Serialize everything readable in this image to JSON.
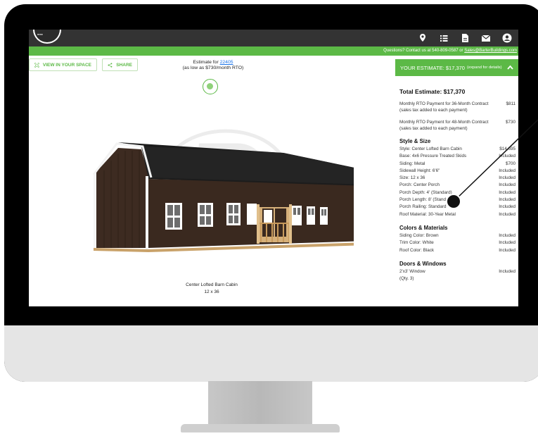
{
  "greenbar": {
    "prefix": "Questions? Contact us at 540-809-0587 or ",
    "email": "Sales@BarterBuildings.com"
  },
  "viewer": {
    "view_label": "VIEW IN YOUR SPACE",
    "share_label": "SHARE",
    "estimate_prefix": "Estimate for ",
    "zip": "22405",
    "rto_line": "(as low as $730/month RTO)",
    "model_name": "Center Lofted Barn Cabin",
    "model_size": "12 x 36"
  },
  "panel": {
    "header_main": "YOUR ESTIMATE: $17,370",
    "header_small": "(expand for details)",
    "total": "Total Estimate: $17,370",
    "payments": [
      {
        "label": "Monthly RTO Payment for 36-Month Contract (sales tax added to each payment)",
        "value": "$811"
      },
      {
        "label": "Monthly RTO Payment for 48-Month Contract (sales tax added to each payment)",
        "value": "$730"
      }
    ],
    "sections": {
      "style": {
        "title": "Style & Size",
        "rows": [
          {
            "label": "Style: Center Lofted Barn Cabin",
            "value": "$14,695"
          },
          {
            "label": "Base: 4x6 Pressure Treated Skids",
            "value": "Included"
          },
          {
            "label": "Siding: Metal",
            "value": "$700"
          },
          {
            "label": "Sidewall Height: 6'6\"",
            "value": "Included"
          },
          {
            "label": "Size: 12 x 36",
            "value": "Included"
          },
          {
            "label": "Porch: Center Porch",
            "value": "Included"
          },
          {
            "label": "Porch Depth: 4' (Standard)",
            "value": "Included"
          },
          {
            "label": "Porch Length: 8' (Standard)",
            "value": "Included"
          },
          {
            "label": "Porch Railing: Standard",
            "value": "Included"
          },
          {
            "label": "Roof Material: 30-Year Metal",
            "value": "Included"
          }
        ]
      },
      "colors": {
        "title": "Colors & Materials",
        "rows": [
          {
            "label": "Siding Color: Brown",
            "value": "Included"
          },
          {
            "label": "Trim Color: White",
            "value": "Included"
          },
          {
            "label": "Roof Color: Black",
            "value": "Included"
          }
        ]
      },
      "doors": {
        "title": "Doors & Windows",
        "rows": [
          {
            "label": "2'x3' Window",
            "value": "Included"
          },
          {
            "label": "(Qty. 3)",
            "value": ""
          }
        ]
      }
    }
  },
  "icons": [
    "logo",
    "location-pin-icon",
    "list-icon",
    "document-icon",
    "mail-icon",
    "account-icon",
    "ar-cube-icon",
    "share-icon",
    "chevron-up-icon"
  ],
  "colors": {
    "accent": "#5cb946",
    "topbar": "#333333",
    "siding": "#3d2b21",
    "roof": "#1a1a1a"
  }
}
